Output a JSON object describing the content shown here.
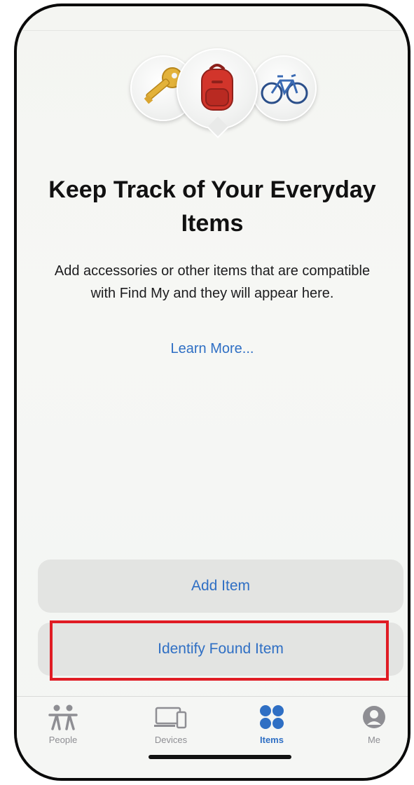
{
  "header": {
    "title": "Keep Track of Your Everyday Items",
    "description": "Add accessories or other items that are compatible with Find My and they will appear here.",
    "learn_more": "Learn More..."
  },
  "illustration": {
    "icons": [
      "key-icon",
      "backpack-icon",
      "bicycle-icon"
    ]
  },
  "actions": {
    "add_item": "Add Item",
    "identify_found_item": "Identify Found Item"
  },
  "tabs": [
    {
      "label": "People",
      "icon": "people-icon",
      "active": false
    },
    {
      "label": "Devices",
      "icon": "devices-icon",
      "active": false
    },
    {
      "label": "Items",
      "icon": "items-icon",
      "active": true
    },
    {
      "label": "Me",
      "icon": "me-icon",
      "active": false
    }
  ],
  "colors": {
    "accent": "#2f6fc4",
    "highlight": "#e01c24",
    "inactive": "#8e8e93"
  }
}
